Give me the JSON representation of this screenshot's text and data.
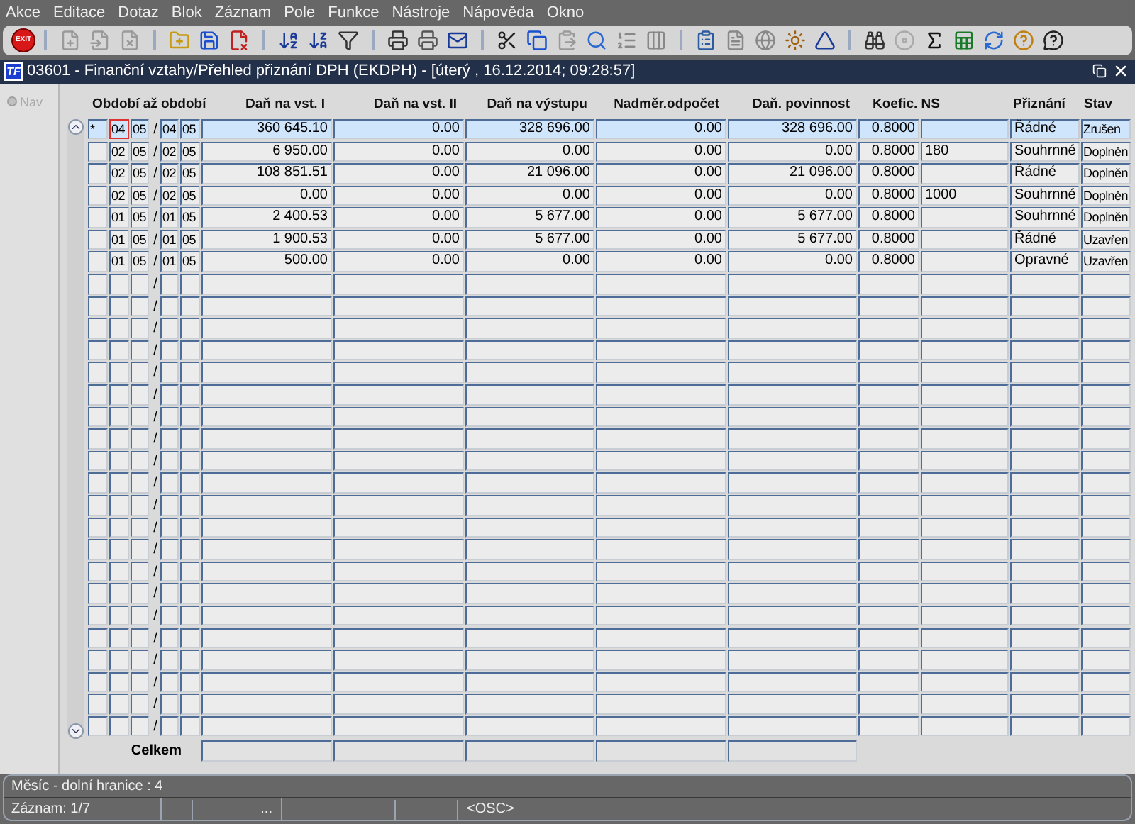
{
  "menu": [
    {
      "label": "Akce"
    },
    {
      "label": "Editace"
    },
    {
      "label": "Dotaz"
    },
    {
      "label": "Blok"
    },
    {
      "label": "Záznam"
    },
    {
      "label": "Pole"
    },
    {
      "label": "Funkce"
    },
    {
      "label": "Nástroje"
    },
    {
      "label": "Nápověda"
    },
    {
      "label": "Okno"
    }
  ],
  "toolbar": {
    "exit_label": "EXIT"
  },
  "window": {
    "title": "03601 - Finanční vztahy/Přehled přiznání DPH (EKDPH) - [úterý  , 16.12.2014; 09:28:57]",
    "logo": "TF"
  },
  "nav": {
    "label": "Nav"
  },
  "table": {
    "period_header": "Období až období",
    "columns": [
      "Daň na vst. I",
      "Daň na vst. II",
      "Daň na výstupu",
      "Nadměr.odpočet",
      "Daň. povinnost",
      "Koefic. NS",
      "Přiznání",
      "Stav"
    ],
    "rows": [
      {
        "selected": true,
        "marker": "*",
        "month_from": "04",
        "year_from": "05",
        "separator": "/",
        "month_to": "04",
        "year_to": "05",
        "dan_vst_1": "360 645.10",
        "dan_vst_2": "0.00",
        "dan_vystup": "328 696.00",
        "nadmer": "0.00",
        "povinnost": "328 696.00",
        "koef": "0.8000",
        "priznani": "Řádné",
        "stav": "Zrušen"
      },
      {
        "selected": false,
        "month_from": "02",
        "year_from": "05",
        "separator": "/",
        "month_to": "02",
        "year_to": "05",
        "dan_vst_1": "6 950.00",
        "dan_vst_2": "0.00",
        "dan_vystup": "0.00",
        "nadmer": "0.00",
        "povinnost": "0.00",
        "koef": "0.8000",
        "ns": "180",
        "priznani": "Souhrnné",
        "stav": "Doplněn"
      },
      {
        "selected": false,
        "month_from": "02",
        "year_from": "05",
        "separator": "/",
        "month_to": "02",
        "year_to": "05",
        "dan_vst_1": "108 851.51",
        "dan_vst_2": "0.00",
        "dan_vystup": "21 096.00",
        "nadmer": "0.00",
        "povinnost": "21 096.00",
        "koef": "0.8000",
        "priznani": "Řádné",
        "stav": "Doplněn"
      },
      {
        "selected": false,
        "month_from": "02",
        "year_from": "05",
        "separator": "/",
        "month_to": "02",
        "year_to": "05",
        "dan_vst_1": "0.00",
        "dan_vst_2": "0.00",
        "dan_vystup": "0.00",
        "nadmer": "0.00",
        "povinnost": "0.00",
        "koef": "0.8000",
        "ns": "1000",
        "priznani": "Souhrnné",
        "stav": "Doplněn"
      },
      {
        "selected": false,
        "month_from": "01",
        "year_from": "05",
        "separator": "/",
        "month_to": "01",
        "year_to": "05",
        "dan_vst_1": "2 400.53",
        "dan_vst_2": "0.00",
        "dan_vystup": "5 677.00",
        "nadmer": "0.00",
        "povinnost": "5 677.00",
        "koef": "0.8000",
        "priznani": "Souhrnné",
        "stav": "Doplněn"
      },
      {
        "selected": false,
        "month_from": "01",
        "year_from": "05",
        "separator": "/",
        "month_to": "01",
        "year_to": "05",
        "dan_vst_1": "1 900.53",
        "dan_vst_2": "0.00",
        "dan_vystup": "5 677.00",
        "nadmer": "0.00",
        "povinnost": "5 677.00",
        "koef": "0.8000",
        "priznani": "Řádné",
        "stav": "Uzavřen"
      },
      {
        "selected": false,
        "month_from": "01",
        "year_from": "05",
        "separator": "/",
        "month_to": "01",
        "year_to": "05",
        "dan_vst_1": "500.00",
        "dan_vst_2": "0.00",
        "dan_vystup": "0.00",
        "nadmer": "0.00",
        "povinnost": "0.00",
        "koef": "0.8000",
        "priznani": "Opravné",
        "stav": "Uzavřen"
      },
      {
        "selected": false,
        "separator": "/"
      },
      {
        "selected": false,
        "separator": "/"
      },
      {
        "selected": false,
        "separator": "/"
      },
      {
        "selected": false,
        "separator": "/"
      },
      {
        "selected": false,
        "separator": "/"
      },
      {
        "selected": false,
        "separator": "/"
      },
      {
        "selected": false,
        "separator": "/"
      },
      {
        "selected": false,
        "separator": "/"
      },
      {
        "selected": false,
        "separator": "/"
      },
      {
        "selected": false,
        "separator": "/"
      },
      {
        "selected": false,
        "separator": "/"
      },
      {
        "selected": false,
        "separator": "/"
      },
      {
        "selected": false,
        "separator": "/"
      },
      {
        "selected": false,
        "separator": "/"
      },
      {
        "selected": false,
        "separator": "/"
      },
      {
        "selected": false,
        "separator": "/"
      },
      {
        "selected": false,
        "separator": "/"
      },
      {
        "selected": false,
        "separator": "/"
      },
      {
        "selected": false,
        "separator": "/"
      },
      {
        "selected": false,
        "separator": "/"
      },
      {
        "selected": false,
        "separator": "/"
      }
    ],
    "total": {
      "label": "Celkem"
    }
  },
  "status_bar": {
    "message": "Měsíc - dolní hranice : 4",
    "record": "Záznam: 1/7",
    "ellipsis": "...",
    "mode": "<OSC>"
  }
}
